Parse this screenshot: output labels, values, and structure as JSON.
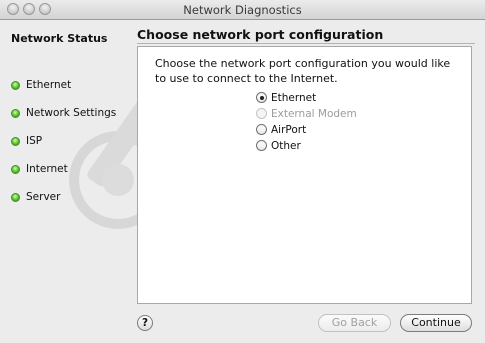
{
  "window": {
    "title": "Network Diagnostics"
  },
  "sidebar": {
    "heading": "Network Status",
    "items": [
      {
        "label": "Ethernet",
        "status_color": "#55c22a"
      },
      {
        "label": "Network Settings",
        "status_color": "#55c22a"
      },
      {
        "label": "ISP",
        "status_color": "#55c22a"
      },
      {
        "label": "Internet",
        "status_color": "#55c22a"
      },
      {
        "label": "Server",
        "status_color": "#55c22a"
      }
    ]
  },
  "main": {
    "heading": "Choose network port configuration",
    "prompt": "Choose the network port configuration you would like to use to connect to the Internet.",
    "options": [
      {
        "label": "Ethernet",
        "selected": true,
        "enabled": true
      },
      {
        "label": "External Modem",
        "selected": false,
        "enabled": false
      },
      {
        "label": "AirPort",
        "selected": false,
        "enabled": true
      },
      {
        "label": "Other",
        "selected": false,
        "enabled": true
      }
    ]
  },
  "footer": {
    "help_label": "?",
    "back_label": "Go Back",
    "continue_label": "Continue"
  }
}
